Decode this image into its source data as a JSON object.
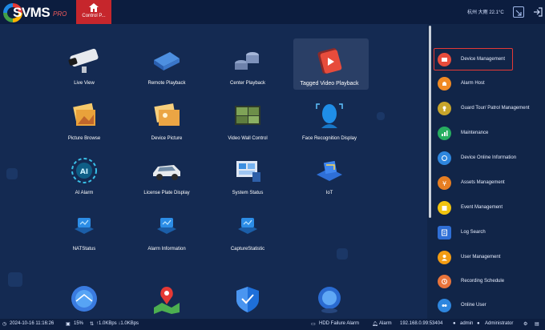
{
  "app": {
    "name": "SVMS",
    "edition": "PRO"
  },
  "topbar": {
    "home_tab_label": "Control P...",
    "weather": "杭州 大雨 22.1°C"
  },
  "main_items": [
    {
      "label": "Live View"
    },
    {
      "label": "Remote Playback"
    },
    {
      "label": "Center Playback"
    },
    {
      "label": "Tagged Video Playback"
    },
    {
      "label": "Picture Browse"
    },
    {
      "label": "Device Picture"
    },
    {
      "label": "Video Wall Control"
    },
    {
      "label": "Face Recognition Display"
    },
    {
      "label": "AI Alarm"
    },
    {
      "label": "License Plate Display"
    },
    {
      "label": "System Status"
    },
    {
      "label": "IoT"
    },
    {
      "label": "NATStatus"
    },
    {
      "label": "Alarm Information"
    },
    {
      "label": "CaptureStatistic"
    }
  ],
  "sidebar": {
    "items": [
      {
        "label": "Device Management",
        "color": "#e74c3c"
      },
      {
        "label": "Alarm Host",
        "color": "#f08a24"
      },
      {
        "label": "Guard Tour/ Patrol Management",
        "color": "#c7a52b"
      },
      {
        "label": "Maintenance",
        "color": "#27ae60"
      },
      {
        "label": "Device Online Information",
        "color": "#2e86de"
      },
      {
        "label": "Assets Management",
        "color": "#e67e22"
      },
      {
        "label": "Event Management",
        "color": "#f1c40f"
      },
      {
        "label": "Log Search",
        "color": "#2f6fd6"
      },
      {
        "label": "User Management",
        "color": "#f39c12"
      },
      {
        "label": "Recording Schedule",
        "color": "#e8743b"
      },
      {
        "label": "Online User",
        "color": "#2e86de"
      }
    ]
  },
  "status": {
    "datetime": "2024-10-16 11:16:26",
    "cpu": "15%",
    "network": "↑1.0KBps ↓1.0KBps",
    "hdd_alarm": "HDD Failure Alarm",
    "alarm": "Alarm",
    "server": "192.168.0.99:53404",
    "user": "admin",
    "role": "Administrator"
  }
}
